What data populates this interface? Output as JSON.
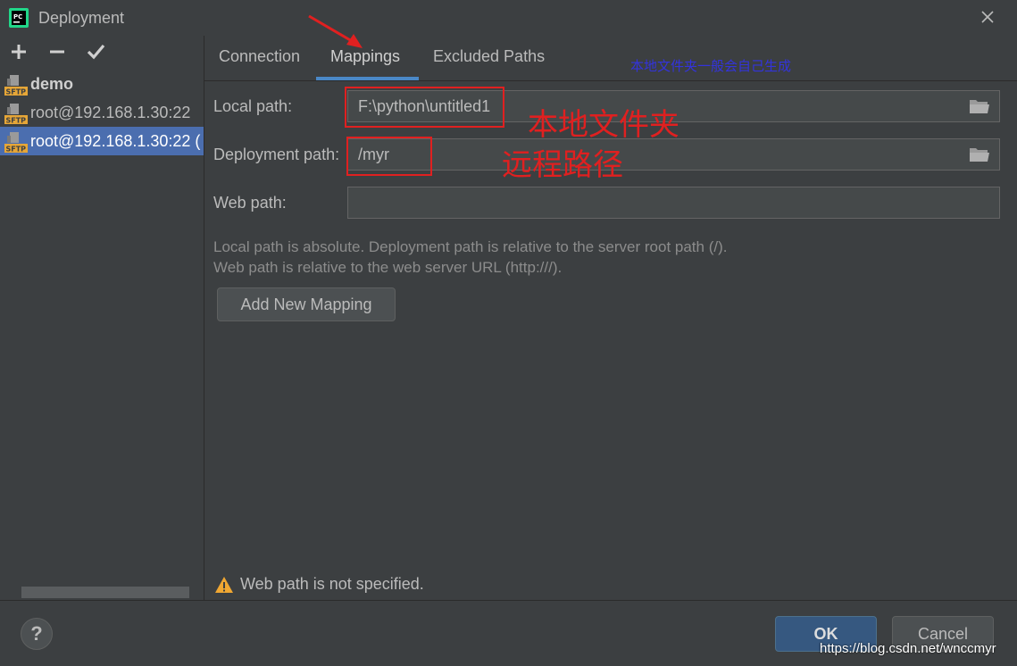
{
  "window": {
    "title": "Deployment"
  },
  "toolbar": {
    "add_icon": "plus-icon",
    "remove_icon": "minus-icon",
    "apply_icon": "check-icon"
  },
  "servers": [
    {
      "label": "demo",
      "icon": "sftp-icon",
      "bold": true,
      "selected": false
    },
    {
      "label": "root@192.168.1.30:22",
      "icon": "sftp-icon",
      "bold": false,
      "selected": false
    },
    {
      "label": "root@192.168.1.30:22 (",
      "icon": "sftp-icon",
      "bold": false,
      "selected": true
    }
  ],
  "tabs": [
    {
      "label": "Connection",
      "active": false
    },
    {
      "label": "Mappings",
      "active": true
    },
    {
      "label": "Excluded Paths",
      "active": false
    }
  ],
  "annotations": {
    "blue_note": "本地文件夹一般会自己生成",
    "local_note": "本地文件夹",
    "remote_note": "远程路径"
  },
  "fields": {
    "local_path": {
      "label": "Local path:",
      "value": "F:\\python\\untitled1"
    },
    "deployment_path": {
      "label": "Deployment path:",
      "value": "/myr"
    },
    "web_path": {
      "label": "Web path:",
      "value": ""
    }
  },
  "hints": {
    "line1": "Local path is absolute. Deployment path is relative to the server root path (/).",
    "line2": "Web path is relative to the web server URL (http:///)."
  },
  "add_mapping_label": "Add New Mapping",
  "warning": {
    "icon": "warning-icon",
    "text": "Web path is not specified."
  },
  "buttons": {
    "help": "?",
    "ok": "OK",
    "cancel": "Cancel"
  },
  "watermark": "https://blog.csdn.net/wnccmyr",
  "colors": {
    "background": "#3c3f41",
    "selection": "#4b6eaf",
    "tab_underline": "#4a88c7",
    "annotation_red": "#e02020",
    "annotation_blue": "#3333dd",
    "ok_button": "#365880"
  }
}
